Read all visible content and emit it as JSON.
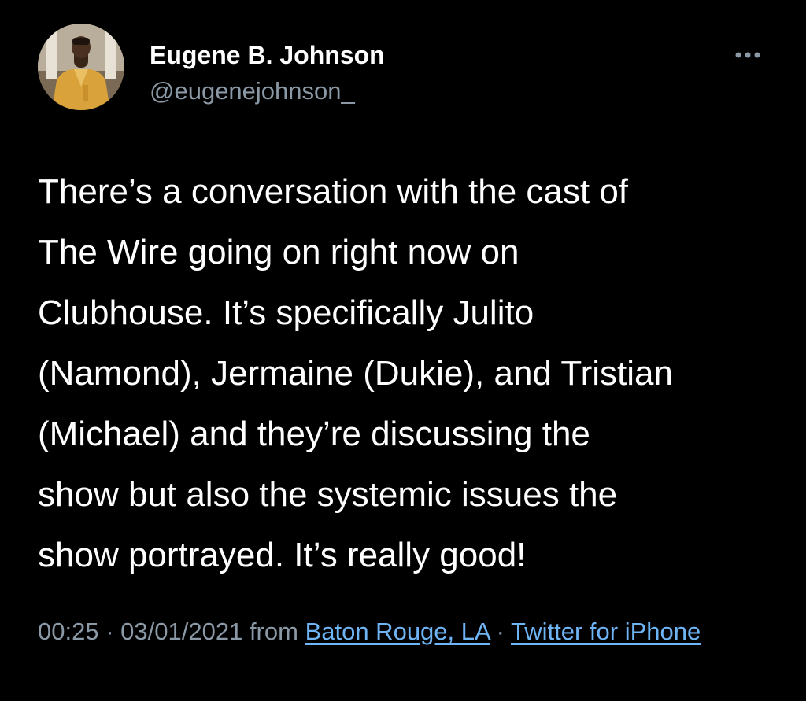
{
  "author": {
    "display_name": "Eugene B. Johnson",
    "handle": "@eugenejohnson_"
  },
  "more_icon": "more-horizontal-icon",
  "tweet": {
    "lines": [
      "There’s a conversation with the cast of",
      "The Wire going on right now on",
      "Clubhouse. It’s specifically Julito",
      "(Namond), Jermaine (Dukie), and Tristian",
      "(Michael) and they’re discussing the",
      "show but also the systemic issues the",
      "show portrayed. It’s really good!"
    ]
  },
  "meta": {
    "time": "00:25",
    "separator": "·",
    "date": "03/01/2021",
    "from_label": "from",
    "location": "Baton Rouge, LA",
    "source": "Twitter for iPhone"
  },
  "colors": {
    "background": "#000000",
    "text": "#ffffff",
    "secondary": "#8b98a5",
    "link": "#6fb5f5"
  }
}
